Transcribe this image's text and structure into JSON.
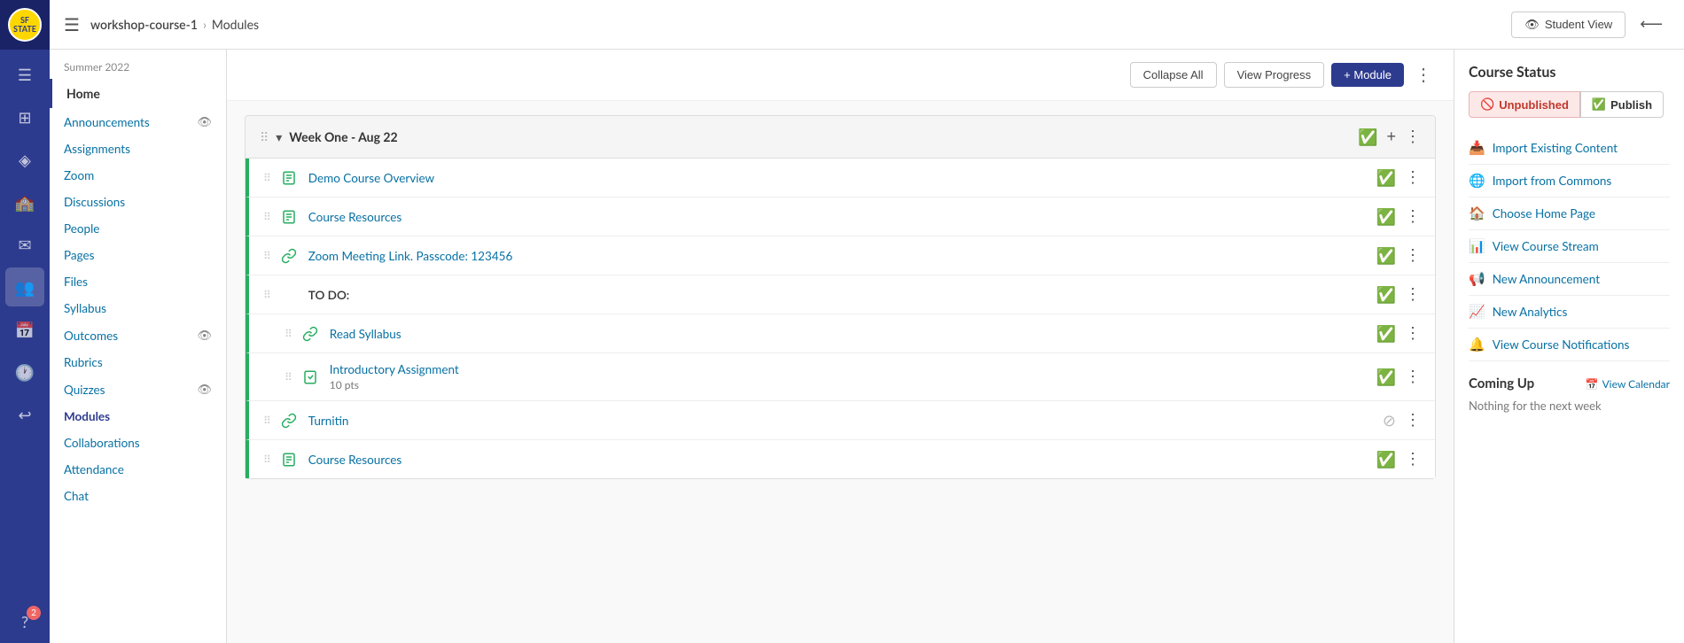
{
  "topbar": {
    "hamburger_label": "☰",
    "course_name": "workshop-course-1",
    "separator": "›",
    "current_page": "Modules",
    "student_view_label": "Student View",
    "student_view_icon": "👁",
    "collapse_icon": "⟵"
  },
  "left_nav": {
    "term": "Summer 2022",
    "home": "Home",
    "items": [
      {
        "label": "Announcements",
        "has_icon": true
      },
      {
        "label": "Assignments",
        "has_icon": false
      },
      {
        "label": "Zoom",
        "has_icon": false
      },
      {
        "label": "Discussions",
        "has_icon": false
      },
      {
        "label": "People",
        "has_icon": false
      },
      {
        "label": "Pages",
        "has_icon": false
      },
      {
        "label": "Files",
        "has_icon": false
      },
      {
        "label": "Syllabus",
        "has_icon": false
      },
      {
        "label": "Outcomes",
        "has_icon": true
      },
      {
        "label": "Rubrics",
        "has_icon": false
      },
      {
        "label": "Quizzes",
        "has_icon": true
      },
      {
        "label": "Modules",
        "has_icon": false
      },
      {
        "label": "Collaborations",
        "has_icon": false
      },
      {
        "label": "Attendance",
        "has_icon": false
      },
      {
        "label": "Chat",
        "has_icon": false
      }
    ]
  },
  "toolbar": {
    "collapse_all": "Collapse All",
    "view_progress": "View Progress",
    "add_module": "+ Module",
    "dots": "⋮"
  },
  "module": {
    "title": "Week One - Aug 22",
    "items": [
      {
        "type": "page",
        "title": "Demo Course Overview",
        "subtitle": "",
        "published": true,
        "indented": false
      },
      {
        "type": "page",
        "title": "Course Resources",
        "subtitle": "",
        "published": true,
        "indented": false
      },
      {
        "type": "link",
        "title": "Zoom Meeting Link. Passcode: 123456",
        "subtitle": "",
        "published": true,
        "indented": false
      },
      {
        "type": "header",
        "title": "TO DO:",
        "subtitle": "",
        "published": true,
        "indented": false
      },
      {
        "type": "link",
        "title": "Read Syllabus",
        "subtitle": "",
        "published": true,
        "indented": true
      },
      {
        "type": "assignment",
        "title": "Introductory Assignment",
        "subtitle": "10 pts",
        "published": true,
        "indented": true
      },
      {
        "type": "link",
        "title": "Turnitin",
        "subtitle": "",
        "published": false,
        "indented": false
      },
      {
        "type": "page",
        "title": "Course Resources",
        "subtitle": "",
        "published": true,
        "indented": false
      }
    ]
  },
  "right_sidebar": {
    "course_status_title": "Course Status",
    "unpublished_label": "Unpublished",
    "publish_label": "Publish",
    "actions": [
      {
        "icon": "📥",
        "label": "Import Existing Content"
      },
      {
        "icon": "🌐",
        "label": "Import from Commons"
      },
      {
        "icon": "🏠",
        "label": "Choose Home Page"
      },
      {
        "icon": "📊",
        "label": "View Course Stream"
      },
      {
        "icon": "📢",
        "label": "New Announcement"
      },
      {
        "icon": "📈",
        "label": "New Analytics"
      },
      {
        "icon": "🔔",
        "label": "View Course Notifications"
      }
    ],
    "coming_up_title": "Coming Up",
    "view_calendar_label": "View Calendar",
    "nothing_text": "Nothing for the next week"
  },
  "icon_sidebar": {
    "logo_text": "SF STATE",
    "icons": [
      {
        "name": "menu-icon",
        "symbol": "☰"
      },
      {
        "name": "dashboard-icon",
        "symbol": "⊞"
      },
      {
        "name": "bookmark-icon",
        "symbol": "🔖"
      },
      {
        "name": "calendar-icon",
        "symbol": "📅"
      },
      {
        "name": "inbox-icon",
        "symbol": "✉"
      },
      {
        "name": "people-icon",
        "symbol": "👥"
      },
      {
        "name": "history-icon",
        "symbol": "🕐"
      },
      {
        "name": "undo-icon",
        "symbol": "↩"
      },
      {
        "name": "help-icon",
        "symbol": "?"
      }
    ]
  }
}
